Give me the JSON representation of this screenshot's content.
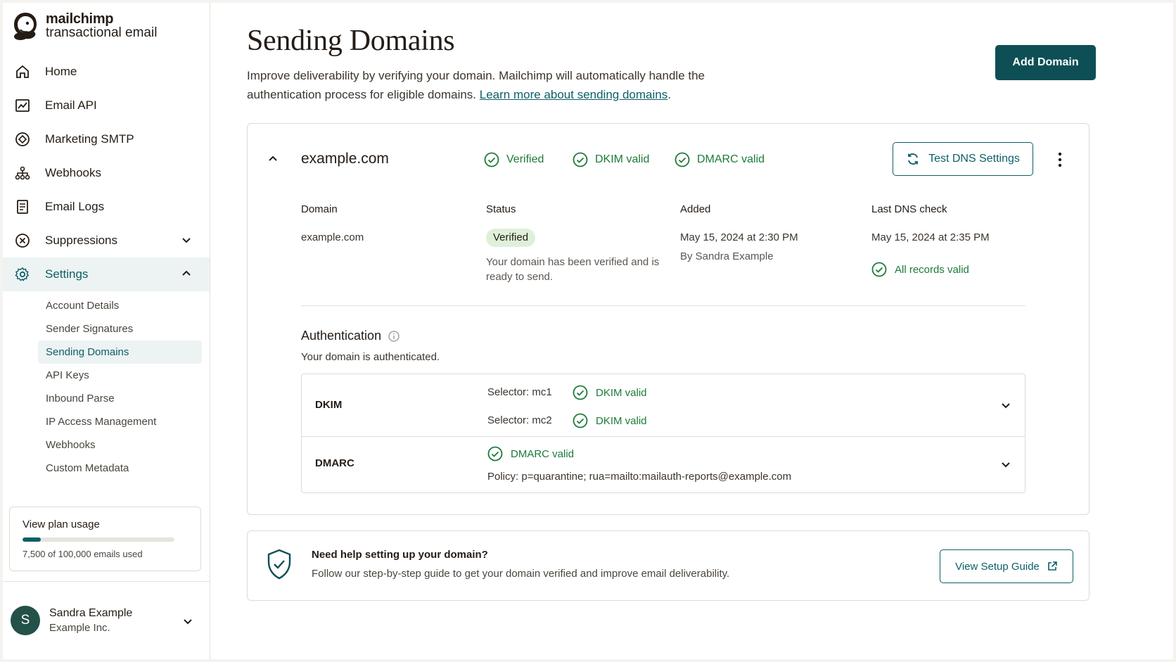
{
  "brand": {
    "name": "mailchimp",
    "subtitle": "transactional email"
  },
  "sidebar": {
    "nav": [
      {
        "label": "Home",
        "icon": "home-icon"
      },
      {
        "label": "Email API",
        "icon": "chart-icon"
      },
      {
        "label": "Marketing SMTP",
        "icon": "diamond-icon"
      },
      {
        "label": "Webhooks",
        "icon": "webhooks-icon"
      },
      {
        "label": "Email Logs",
        "icon": "document-icon"
      },
      {
        "label": "Suppressions",
        "icon": "block-icon"
      },
      {
        "label": "Settings",
        "icon": "gear-icon"
      }
    ],
    "settings_sub": [
      "Account Details",
      "Sender Signatures",
      "Sending Domains",
      "API Keys",
      "Inbound Parse",
      "IP Access Management",
      "Webhooks",
      "Custom Metadata"
    ],
    "plan": {
      "title": "View plan usage",
      "usage_text": "7,500 of 100,000 emails used",
      "used_fraction": 0.075
    },
    "user": {
      "initial": "S",
      "name": "Sandra Example",
      "org": "Example Inc."
    }
  },
  "page": {
    "title": "Sending Domains",
    "intro": "Improve deliverability by verifying your domain. Mailchimp will automatically handle the authentication process for eligible domains.",
    "learn_more": "Learn more about sending domains",
    "add_button": "Add Domain"
  },
  "domain": {
    "name": "example.com",
    "badges": [
      "Verified",
      "DKIM valid",
      "DMARC valid"
    ],
    "test_button": "Test DNS Settings",
    "columns": {
      "domain_label": "Domain",
      "status_label": "Status",
      "added_label": "Added",
      "last_check_label": "Last DNS check"
    },
    "domain_value": "example.com",
    "status_badge": "Verified",
    "status_desc": "Your domain has been verified and is ready to send.",
    "added_date": "May 15, 2024 at 2:30 PM",
    "added_by": "By Sandra Example",
    "last_check_date": "May 15, 2024 at 2:35 PM",
    "records_status": "All records valid",
    "auth": {
      "title": "Authentication",
      "subtitle": "Your domain is authenticated.",
      "dkim": {
        "label": "DKIM",
        "selectors": [
          {
            "selector": "Selector: mc1",
            "status": "DKIM valid"
          },
          {
            "selector": "Selector: mc2",
            "status": "DKIM valid"
          }
        ]
      },
      "dmarc": {
        "label": "DMARC",
        "status": "DMARC valid",
        "policy": "Policy: p=quarantine; rua=mailto:mailauth-reports@example.com"
      }
    }
  },
  "help": {
    "title": "Need help setting up your domain?",
    "subtitle": "Follow our step-by-step guide to get your domain verified and improve email deliverability.",
    "button": "View Setup Guide"
  },
  "colors": {
    "accent": "#0d5f68",
    "primary_button": "#0d4f55",
    "success": "#1d7a3a",
    "badge_bg": "#dff0d8"
  }
}
